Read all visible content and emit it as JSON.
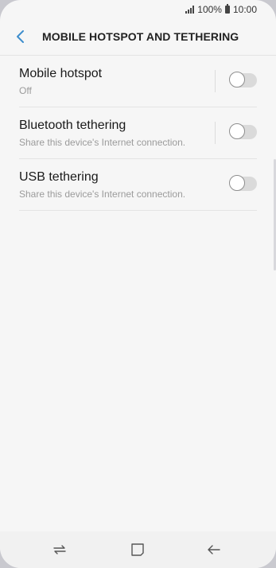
{
  "status_bar": {
    "battery_text": "100%",
    "time": "10:00"
  },
  "header": {
    "title": "MOBILE HOTSPOT AND TETHERING",
    "back_icon": "chevron-left-icon"
  },
  "settings": [
    {
      "label": "Mobile hotspot",
      "sub": "Off",
      "toggle": false,
      "has_divider": true
    },
    {
      "label": "Bluetooth tethering",
      "sub": "Share this device's Internet connection.",
      "toggle": false,
      "has_divider": true
    },
    {
      "label": "USB tethering",
      "sub": "Share this device's Internet connection.",
      "toggle": false,
      "has_divider": false
    }
  ],
  "navigation": {
    "recent_icon": "recent-apps-icon",
    "home_icon": "home-icon",
    "back_icon": "back-arrow-icon"
  },
  "colors": {
    "accent": "#3e8ecd",
    "background": "#f6f6f6"
  }
}
